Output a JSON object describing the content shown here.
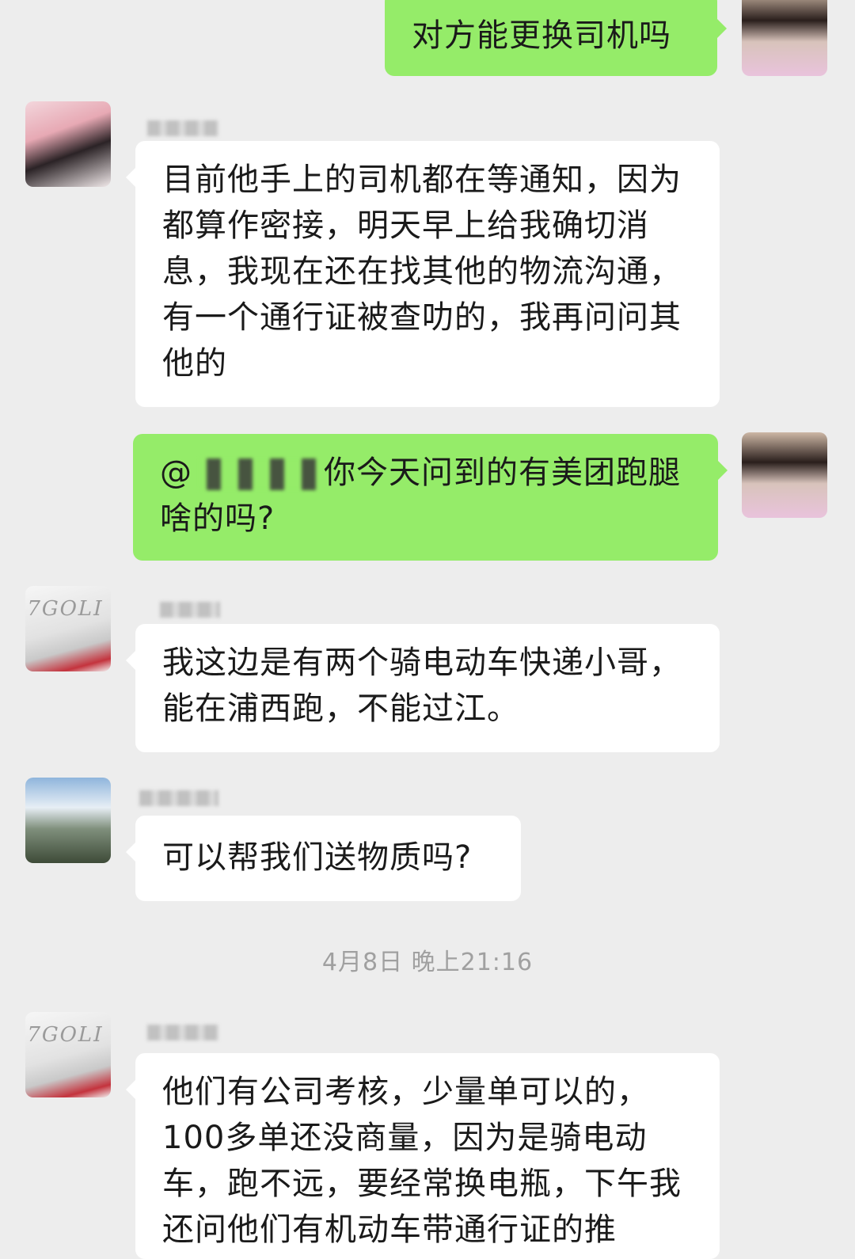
{
  "messages": {
    "m1": {
      "text": "对方能更换司机吗"
    },
    "m2": {
      "text": "目前他手上的司机都在等通知，因为都算作密接，明天早上给我确切消息，我现在还在找其他的物流沟通，有一个通行证被查叻的，我再问问其他的"
    },
    "m3": {
      "mention": "@",
      "text": "你今天问到的有美团跑腿啥的吗?"
    },
    "m4": {
      "text": "我这边是有两个骑电动车快递小哥，能在浦西跑，不能过江。"
    },
    "m5": {
      "text": "可以帮我们送物质吗?"
    },
    "m6": {
      "text": "他们有公司考核，少量单可以的，100多单还没商量，因为是骑电动车，跑不远，要经常换电瓶，下午我还问他们有机动车带通行证的推"
    }
  },
  "timestamp": "4月8日 晚上21:16",
  "avatar_text": {
    "car": "7GOLI"
  },
  "colors": {
    "background": "#ededed",
    "sent_bubble": "#95ec69",
    "received_bubble": "#ffffff"
  }
}
